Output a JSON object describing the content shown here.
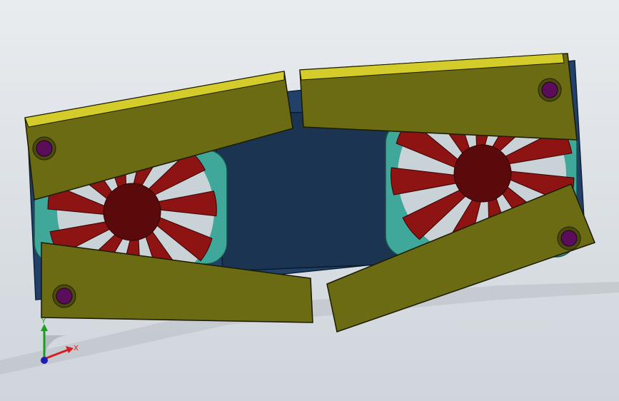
{
  "viewport": {
    "background_top": "#e9ecef",
    "background_bottom": "#cfd5db"
  },
  "colors": {
    "panel_olive": "#6b6b13",
    "panel_edge_yellow": "#d4cc2a",
    "fan_blade_red": "#8e1414",
    "fan_hub_red": "#5a0a0a",
    "fan_frame_teal": "#3fa89a",
    "center_body_navy": "#1b3452",
    "bolt_purple": "#5a0e5a"
  },
  "assembly": {
    "name": "fan-cooler-assembly",
    "panels": [
      "top-left-panel",
      "top-right-panel",
      "bottom-left-panel",
      "bottom-right-panel"
    ],
    "fans": [
      "left-fan",
      "right-fan"
    ],
    "bolts": 4
  },
  "triad": {
    "x_label": "X",
    "y_label": "Y",
    "x_color": "#d22020",
    "y_color": "#18a018",
    "z_color": "#1c1cb0"
  }
}
